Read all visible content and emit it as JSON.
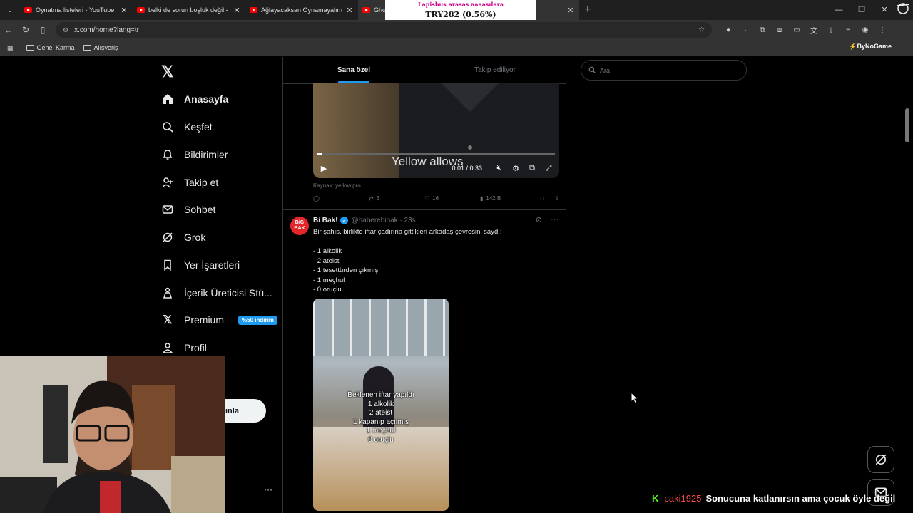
{
  "browser": {
    "tabs": [
      {
        "title": "Oynatma listeleri - YouTube"
      },
      {
        "title": "belki de sorun boşluk değil - Yo"
      },
      {
        "title": "Ağlayacaksan Oynamayalım - Yo"
      },
      {
        "title": "Ghost"
      }
    ],
    "url": "x.com/home?lang=tr",
    "bookmarks": [
      "Genel Karma",
      "Alışveriş"
    ],
    "bynogame": "ByNoGame"
  },
  "overlay": {
    "ticker_top": "Lapisbus arasas aaaasılara",
    "ticker": "TRY282 (0.56%)"
  },
  "sidebar": {
    "items": [
      {
        "label": "Anasayfa",
        "icon": "home-icon"
      },
      {
        "label": "Keşfet",
        "icon": "search-icon"
      },
      {
        "label": "Bildirimler",
        "icon": "bell-icon"
      },
      {
        "label": "Takip et",
        "icon": "user-plus-icon"
      },
      {
        "label": "Sohbet",
        "icon": "mail-icon"
      },
      {
        "label": "Grok",
        "icon": "grok-icon"
      },
      {
        "label": "Yer İşaretleri",
        "icon": "bookmark-icon"
      },
      {
        "label": "İçerik Üreticisi Stü...",
        "icon": "creator-studio-icon"
      },
      {
        "label": "Premium",
        "icon": "x-icon"
      },
      {
        "label": "Profil",
        "icon": "profile-icon"
      }
    ],
    "premium_badge": "%50 indirim",
    "post_button": "ınla"
  },
  "feed": {
    "tabs": [
      "Sana özel",
      "Takip ediliyor"
    ],
    "video": {
      "subtitle": "Yellow allows",
      "time": "0:01 / 0:33",
      "source": "Kaynak: yellow.pro",
      "retweets": "3",
      "likes": "16",
      "views": "142 B"
    },
    "post": {
      "avatar_text": "BiG BAK",
      "name": "Bi Bak!",
      "handle": "@haberebibak · 23s",
      "text": "Bir şahıs, birlikte iftar çadırına gittikleri arkadaş çevresini saydı:\n\n- 1 alkolik\n- 2 ateist\n- 1 tesettürden çıkmış\n- 1 meçhul\n- 0 oruçlu",
      "image_overlay": "Beklenen iftar yapıldı\n1 alkolik\n2 ateist\n1 kapanıp açılmış\n1 meçhul\n0 oruçlu"
    }
  },
  "search": {
    "placeholder": "Ara"
  },
  "chat": {
    "badge": "K",
    "user": "caki1925",
    "message": "Sonucuna katlanırsın ama çocuk öyle değil"
  }
}
